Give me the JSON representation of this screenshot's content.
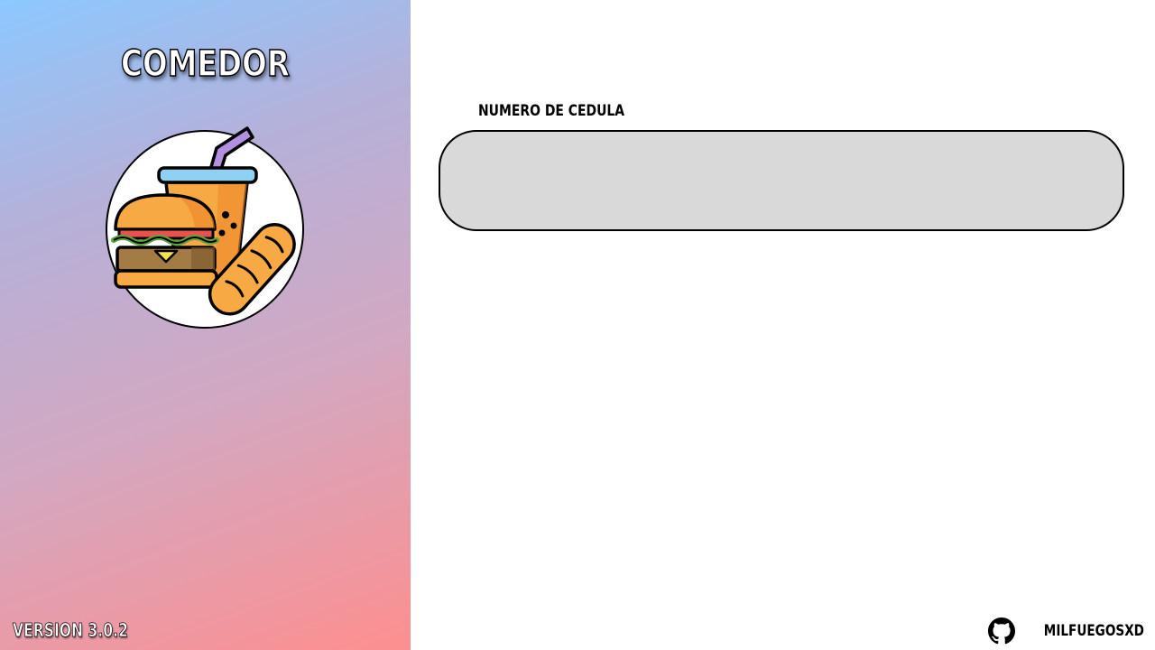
{
  "sidebar": {
    "title": "COMEDOR",
    "logo_icon": "food-combo-icon",
    "version": "VERSION 3.0.2",
    "gradient_colors": [
      "#8cc8ff",
      "#b6b0d8",
      "#d2a8c2",
      "#fd8f8f"
    ]
  },
  "form": {
    "cedula_label": "NUMERO DE CEDULA",
    "cedula_value": "",
    "cedula_placeholder": "",
    "input_background": "#d9d9d9"
  },
  "footer": {
    "github_icon": "github-icon",
    "author": "MILFUEGOSXD"
  }
}
